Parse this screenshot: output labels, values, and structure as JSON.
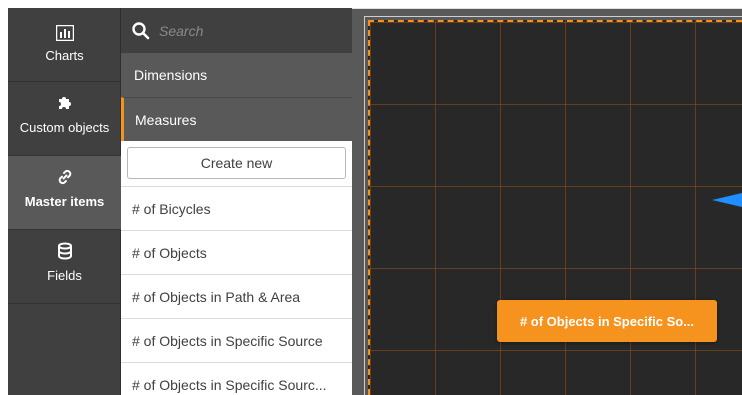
{
  "rail": {
    "items": [
      {
        "label": "Charts",
        "icon": "bar-chart-icon",
        "active": false
      },
      {
        "label": "Custom objects",
        "icon": "puzzle-icon",
        "active": false
      },
      {
        "label": "Master items",
        "icon": "link-icon",
        "active": true
      },
      {
        "label": "Fields",
        "icon": "database-icon",
        "active": false
      }
    ]
  },
  "panel": {
    "search": {
      "placeholder": "Search",
      "value": ""
    },
    "sections": {
      "dimensions": "Dimensions",
      "measures": "Measures"
    },
    "create_new_label": "Create new",
    "measures": [
      "# of Bicycles",
      "# of Objects",
      "# of Objects in Path & Area",
      "# of Objects in Specific Source",
      "# of Objects in Specific Sourc..."
    ]
  },
  "canvas": {
    "drag_chip_label": "# of Objects in Specific So..."
  },
  "colors": {
    "rail_bg": "#404040",
    "rail_active": "#595959",
    "accent": "#f6931e",
    "canvas_bg": "#282828",
    "drop_arrow": "#1f8fff"
  }
}
